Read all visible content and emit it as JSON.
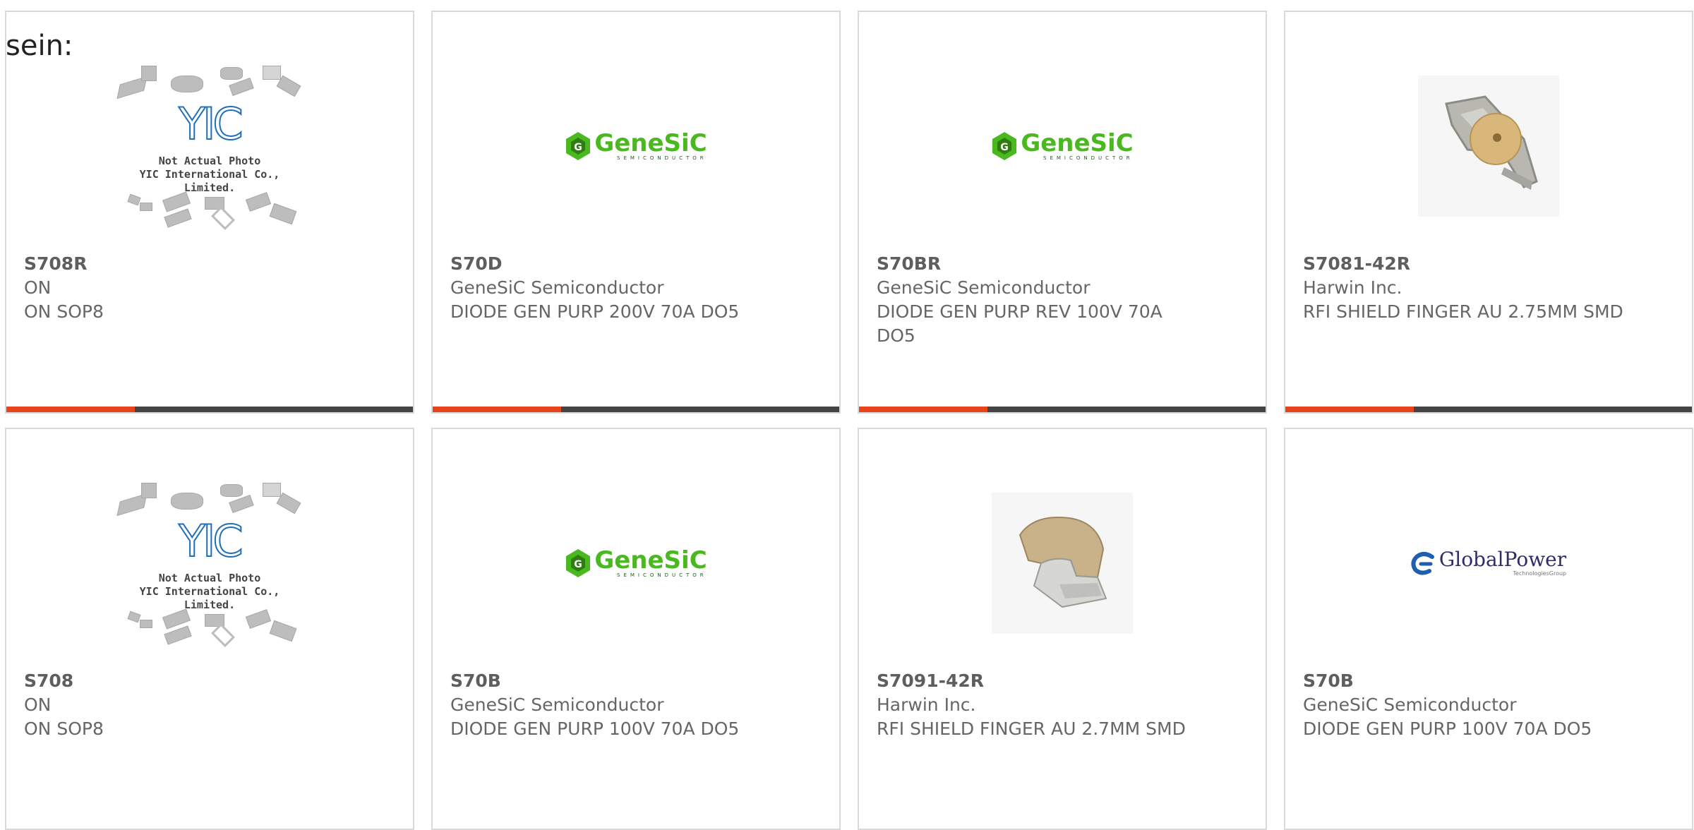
{
  "lead_text": "sein:",
  "cards": [
    {
      "part_number": "S708R",
      "manufacturer": "ON",
      "description": "ON SOP8",
      "image": "yic-placeholder",
      "image_caption": [
        "Not Actual Photo",
        "YIC International Co., Limited."
      ],
      "image_logo": "YIC"
    },
    {
      "part_number": "S70D",
      "manufacturer": "GeneSiC Semiconductor",
      "description": "DIODE GEN PURP 200V 70A DO5",
      "image": "genesic-logo",
      "image_logo": "GeneSiC",
      "image_logo_sub": "SEMICONDUCTOR"
    },
    {
      "part_number": "S70BR",
      "manufacturer": "GeneSiC Semiconductor",
      "description": "DIODE GEN PURP REV 100V 70A DO5",
      "image": "genesic-logo",
      "image_logo": "GeneSiC",
      "image_logo_sub": "SEMICONDUCTOR"
    },
    {
      "part_number": "S7081-42R",
      "manufacturer": "Harwin Inc.",
      "description": "RFI SHIELD FINGER AU 2.75MM SMD",
      "image": "shield-finger-photo"
    },
    {
      "part_number": "S708",
      "manufacturer": "ON",
      "description": "ON SOP8",
      "image": "yic-placeholder",
      "image_caption": [
        "Not Actual Photo",
        "YIC International Co., Limited."
      ],
      "image_logo": "YIC"
    },
    {
      "part_number": "S70B",
      "manufacturer": "GeneSiC Semiconductor",
      "description": "DIODE GEN PURP 100V 70A DO5",
      "image": "genesic-logo",
      "image_logo": "GeneSiC",
      "image_logo_sub": "SEMICONDUCTOR"
    },
    {
      "part_number": "S7091-42R",
      "manufacturer": "Harwin Inc.",
      "description": "RFI SHIELD FINGER AU 2.7MM SMD",
      "image": "shield-finger-photo"
    },
    {
      "part_number": "S70B",
      "manufacturer": "GeneSiC Semiconductor",
      "description": "DIODE GEN PURP 100V 70A DO5",
      "image": "globalpower-logo",
      "image_logo": "GlobalPower",
      "image_logo_sub": "TechnologiesGroup"
    }
  ],
  "colors": {
    "accent_bar": "#e8441c",
    "bar": "#444444",
    "border": "#d9d9d9",
    "text": "#666666"
  }
}
